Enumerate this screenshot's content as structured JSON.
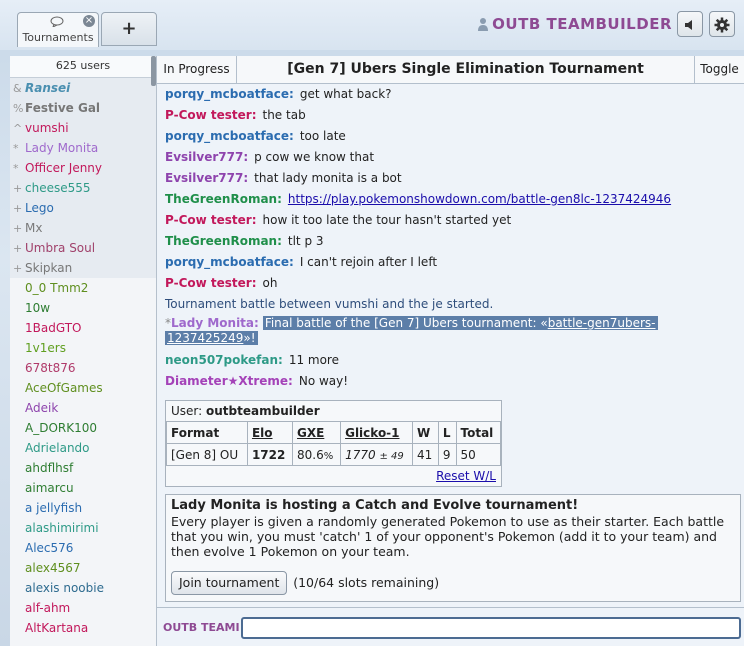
{
  "header": {
    "tab_label": "Tournaments",
    "new_tab_label": "+",
    "username": "OUTB TEAMBUILDER",
    "close_glyph": "×"
  },
  "userlist": {
    "count": "625 users",
    "users": [
      {
        "rank": "&",
        "name": "Ransei",
        "color": "#4a8fb0",
        "style": "bold italic"
      },
      {
        "rank": "%",
        "name": "Festive Gal",
        "color": "#777777",
        "style": "bold"
      },
      {
        "rank": "^",
        "name": "vumshi",
        "color": "#c2185b",
        "style": ""
      },
      {
        "rank": "*",
        "name": "Lady Monita",
        "color": "#9f69cc",
        "style": ""
      },
      {
        "rank": "*",
        "name": "Officer Jenny",
        "color": "#c2185b",
        "style": ""
      },
      {
        "rank": "+",
        "name": "cheese555",
        "color": "#2e9a87",
        "style": ""
      },
      {
        "rank": "+",
        "name": "Lego",
        "color": "#2b6cb0",
        "style": ""
      },
      {
        "rank": "+",
        "name": "Mx",
        "color": "#7a7a7a",
        "style": ""
      },
      {
        "rank": "+",
        "name": "Umbra Soul",
        "color": "#a0416b",
        "style": ""
      },
      {
        "rank": "+",
        "name": "Skipkan",
        "color": "#777777",
        "style": ""
      },
      {
        "rank": "",
        "name": "0_0 Tmm2",
        "color": "#5f8f1f",
        "style": ""
      },
      {
        "rank": "",
        "name": "10w",
        "color": "#2e7d32",
        "style": ""
      },
      {
        "rank": "",
        "name": "1BadGTO",
        "color": "#c2185b",
        "style": ""
      },
      {
        "rank": "",
        "name": "1v1ers",
        "color": "#5f9f1f",
        "style": ""
      },
      {
        "rank": "",
        "name": "678t876",
        "color": "#b03a6a",
        "style": ""
      },
      {
        "rank": "",
        "name": "AceOfGames",
        "color": "#5f8f1f",
        "style": ""
      },
      {
        "rank": "",
        "name": "Adeik",
        "color": "#8e44ad",
        "style": ""
      },
      {
        "rank": "",
        "name": "A_DORK100",
        "color": "#2e7d32",
        "style": ""
      },
      {
        "rank": "",
        "name": "Adrielando",
        "color": "#2e9a87",
        "style": ""
      },
      {
        "rank": "",
        "name": "ahdflhsf",
        "color": "#2e7d32",
        "style": ""
      },
      {
        "rank": "",
        "name": "aimarcu",
        "color": "#2e7d32",
        "style": ""
      },
      {
        "rank": "",
        "name": "a jellyfish",
        "color": "#2b6cb0",
        "style": ""
      },
      {
        "rank": "",
        "name": "alashimirimi",
        "color": "#2e9a87",
        "style": ""
      },
      {
        "rank": "",
        "name": "Alec576",
        "color": "#2b6cb0",
        "style": ""
      },
      {
        "rank": "",
        "name": "alex4567",
        "color": "#5f8f1f",
        "style": ""
      },
      {
        "rank": "",
        "name": "alexis noobie",
        "color": "#2e6b8f",
        "style": ""
      },
      {
        "rank": "",
        "name": "alf-ahm",
        "color": "#c2185b",
        "style": ""
      },
      {
        "rank": "",
        "name": "AltKartana",
        "color": "#c2185b",
        "style": ""
      }
    ]
  },
  "room": {
    "status": "In Progress",
    "title": "[Gen 7] Ubers Single Elimination Tournament",
    "toggle": "Toggle"
  },
  "messages": [
    {
      "who": "porqy_mcboatface:",
      "color": "#2b6cb0",
      "text": "get what back?"
    },
    {
      "who": "P-Cow tester:",
      "color": "#c2185b",
      "text": "the tab"
    },
    {
      "who": "porqy_mcboatface:",
      "color": "#2b6cb0",
      "text": "too late"
    },
    {
      "who": "Evsilver777:",
      "color": "#8e44ad",
      "text": "p cow we know that"
    },
    {
      "who": "Evsilver777:",
      "color": "#8e44ad",
      "text": "that lady monita is a bot"
    },
    {
      "who": "TheGreenRoman:",
      "color": "#1f8f4a",
      "link": "https://play.pokemonshowdown.com/battle-gen8lc-1237424946"
    },
    {
      "who": "P-Cow tester:",
      "color": "#c2185b",
      "text": "how it too late the tour hasn't started yet"
    },
    {
      "who": "TheGreenRoman:",
      "color": "#1f8f4a",
      "text": "tlt p 3"
    },
    {
      "who": "porqy_mcboatface:",
      "color": "#2b6cb0",
      "text": "I can't rejoin after I left"
    },
    {
      "who": "P-Cow tester:",
      "color": "#c2185b",
      "text": "oh"
    }
  ],
  "notice": "Tournament battle between vumshi and the je started.",
  "announcement": {
    "star": "*",
    "who": "Lady Monita:",
    "text_before": "Final battle of the [Gen 7] Ubers tournament: «",
    "link_part1": "battle-gen7ubers-",
    "link_part2": "1237425249",
    "text_after": "»!"
  },
  "messages_after": [
    {
      "who": "neon507pokefan:",
      "color": "#2e9a87",
      "text": "11 more"
    },
    {
      "who": "Diameter★Xtreme:",
      "color": "#a442b8",
      "text": "No way!"
    }
  ],
  "rankbox": {
    "user_label": "User:",
    "user_name": "outbteambuilder",
    "headers": [
      "Format",
      "Elo",
      "GXE",
      "Glicko-1",
      "W",
      "L",
      "Total"
    ],
    "row": {
      "format": "[Gen 8] OU",
      "elo": "1722",
      "gxe": "80.6",
      "gxe_unit": "%",
      "glicko": "1770",
      "glicko_dev": "± 49",
      "w": "41",
      "l": "9",
      "total": "50"
    },
    "reset": "Reset W/L"
  },
  "tourbox": {
    "title": "Lady Monita is hosting a Catch and Evolve tournament!",
    "description": "Every player is given a randomly generated Pokemon to use as their starter. Each battle that you win, you must 'catch' 1 of your opponent's Pokemon (add it to your team) and then evolve 1 Pokemon on your team.",
    "join_label": "Join tournament",
    "slots": "(10/64 slots remaining)"
  },
  "chatbar": {
    "prefix": "OUTB TEAMI",
    "value": ""
  },
  "colors": {
    "accent": "#8e4a93",
    "link": "#1a0dab",
    "highlight": "#5c7ea8"
  }
}
